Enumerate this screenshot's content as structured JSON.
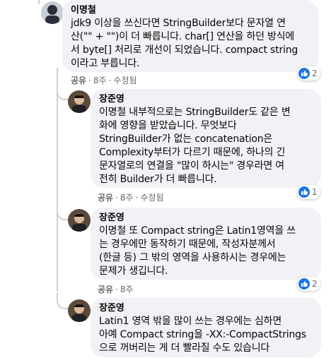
{
  "colors": {
    "bubble": "#f0f2f5",
    "accent": "#1b74e4",
    "muted": "#65676b",
    "line": "#ced0d4"
  },
  "comments": [
    {
      "author": "이명철",
      "text": "jdk9 이상을 쓰신다면 StringBuilder보다 문자열 연\n산(\"\" + \"\")이 더 빠릅니다. char[] 연산을 하던 방식에\n서 byte[] 처리로 개선이 되었습니다. compact string\n이라고 부릅니다.",
      "actions": {
        "share": "공유",
        "time": "8주",
        "edited": "수정됨"
      },
      "reactions": "2"
    },
    {
      "author": "장준영",
      "text": "이명철 내부적으로는 StringBuilder도 같은 변\n화에 영향을 받았습니다. 무엇보다\nStringBuilder가 없는 concatenation은\nComplexity부터가 다르기 때문에, 하나의 긴\n문자열로의 연결을 \"많이 하시는\" 경우라면 여\n전히 Builder가 더 빠릅니다.",
      "actions": {
        "share": "공유",
        "time": "8주",
        "edited": "수정됨"
      },
      "reactions": "1"
    },
    {
      "author": "장준영",
      "text": "이명철 또 Compact string은 Latin1영역을 쓰\n는 경우에만 동작하기 때문에, 작성자분께서\n(한글 등) 그 밖의 영역을 사용하시는 경우에는\n문제가 생깁니다.",
      "actions": {
        "share": "공유",
        "time": "8주"
      },
      "reactions": "2"
    },
    {
      "author": "장준영",
      "text": "Latin1 영역 밖을 많이 쓰는 경우에는 심하면\n아예 Compact string을 -XX:-CompactStrings\n으로 꺼버리는 게 더 빨라질 수도 있습니다"
    }
  ]
}
